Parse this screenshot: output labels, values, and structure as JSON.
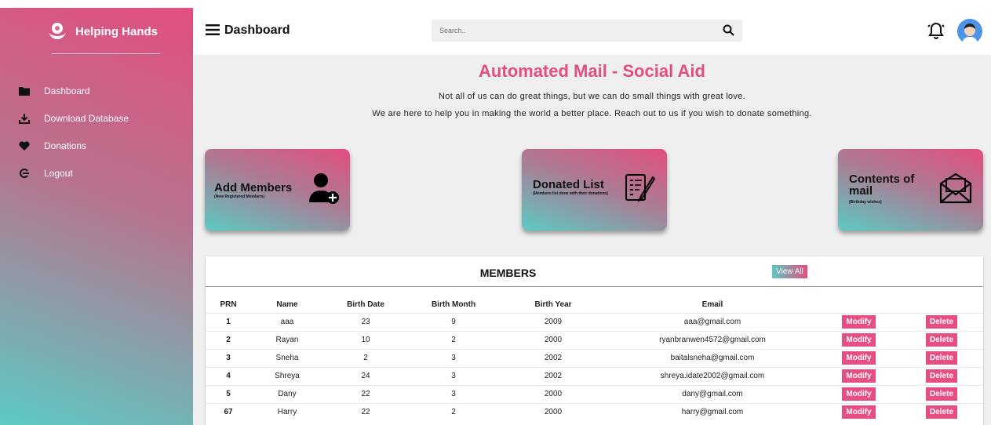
{
  "sidebar": {
    "brand": "Helping Hands",
    "items": [
      {
        "label": "Dashboard",
        "icon": "folder-icon"
      },
      {
        "label": "Download Database",
        "icon": "download-icon"
      },
      {
        "label": "Donations",
        "icon": "heart-icon"
      },
      {
        "label": "Logout",
        "icon": "logout-icon"
      }
    ]
  },
  "header": {
    "title": "Dashboard",
    "search_placeholder": "Search.."
  },
  "hero": {
    "title": "Automated Mail - Social Aid",
    "line1": "Not all of us can do great things, but we can do small things with great love.",
    "line2": "We are here to help you in making the world a better place. Reach out to us if you wish to donate something."
  },
  "cards": [
    {
      "title": "Add Members",
      "subtitle": "(New Registered Members)",
      "icon": "add-user-icon"
    },
    {
      "title": "Donated List",
      "subtitle": "(Members list done with their donations)",
      "icon": "document-list-icon"
    },
    {
      "title": "Contents of mail",
      "subtitle": "(Birthday wishes)",
      "icon": "mail-icon"
    }
  ],
  "members": {
    "title": "MEMBERS",
    "view_all": "View All",
    "columns": [
      "PRN",
      "Name",
      "Birth Date",
      "Birth Month",
      "Birth Year",
      "Email"
    ],
    "modify_label": "Modify",
    "delete_label": "Delete",
    "rows": [
      {
        "prn": "1",
        "name": "aaa",
        "date": "23",
        "month": "9",
        "year": "2009",
        "email": "aaa@gmail.com"
      },
      {
        "prn": "2",
        "name": "Rayan",
        "date": "10",
        "month": "2",
        "year": "2000",
        "email": "ryanbranwen4572@gmail.com"
      },
      {
        "prn": "3",
        "name": "Sneha",
        "date": "2",
        "month": "3",
        "year": "2002",
        "email": "baitalsneha@gmail.com"
      },
      {
        "prn": "4",
        "name": "Shreya",
        "date": "24",
        "month": "3",
        "year": "2002",
        "email": "shreya.idate2002@gmail.com"
      },
      {
        "prn": "5",
        "name": "Dany",
        "date": "22",
        "month": "3",
        "year": "2000",
        "email": "dany@gmail.com"
      },
      {
        "prn": "67",
        "name": "Harry",
        "date": "22",
        "month": "2",
        "year": "2000",
        "email": "harry@gmail.com"
      }
    ]
  },
  "colors": {
    "accent": "#e24e80",
    "teal": "#5ccac3",
    "button": "#e84e82"
  }
}
